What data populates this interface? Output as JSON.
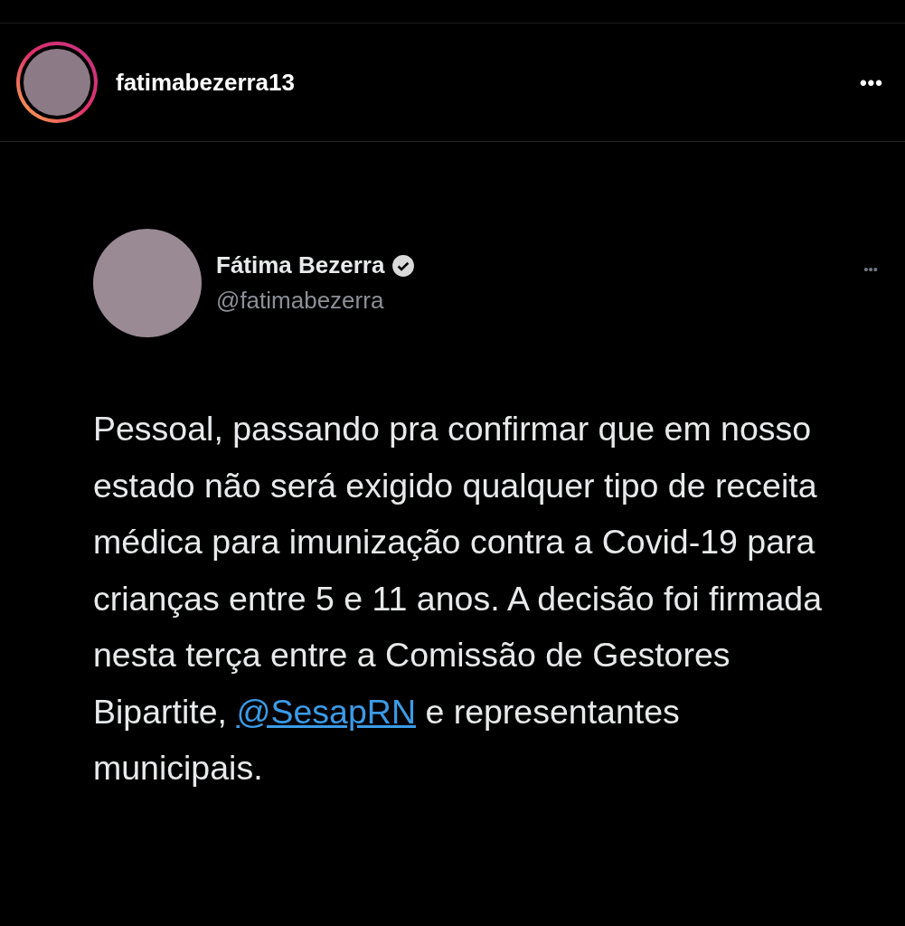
{
  "post_header": {
    "username": "fatimabezerra13",
    "more": "•••"
  },
  "tweet": {
    "name": "Fátima Bezerra",
    "verified": true,
    "handle": "@fatimabezerra",
    "more": "•••",
    "text_before": "Pessoal, passando pra confirmar que em nosso estado não será exigido qualquer tipo de receita médica para imunização contra a Covid-19 para crianças entre 5 e 11 anos. A decisão foi firmada nesta terça entre a Comissão de Gestores Bipartite,",
    "mention": "@SesapRN",
    "text_after": "e representantes municipais."
  }
}
